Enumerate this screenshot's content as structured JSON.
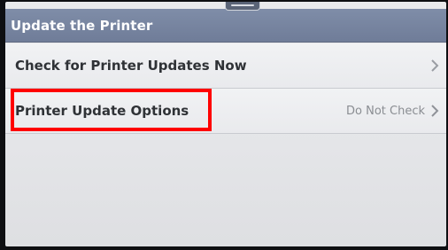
{
  "header": {
    "title": "Update the Printer"
  },
  "menu": {
    "items": [
      {
        "label": "Check for Printer Updates Now",
        "value": ""
      },
      {
        "label": "Printer Update Options",
        "value": "Do Not Check"
      }
    ]
  },
  "icons": {
    "row_chevron": "chevron-right-icon",
    "pull_tab": "pull-down-handle-icon"
  },
  "colors": {
    "header": "#7583a0",
    "highlight": "#ff0000",
    "label_text": "#2f3236",
    "value_text": "#8a8d92"
  }
}
